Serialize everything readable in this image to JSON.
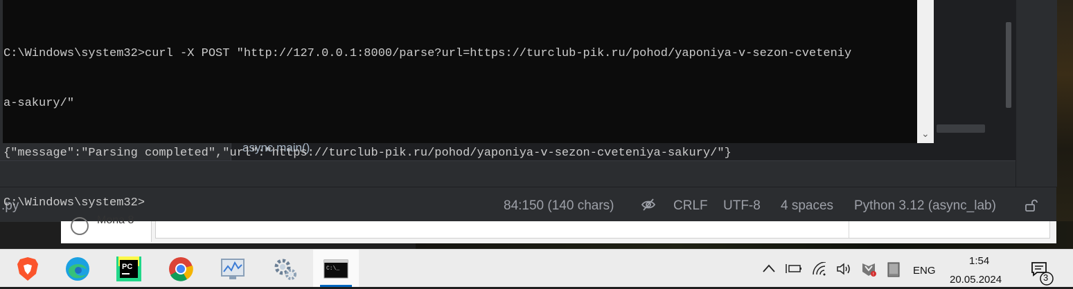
{
  "terminal": {
    "lines": [
      "C:\\Windows\\system32>curl -X POST \"http://127.0.0.1:8000/parse?url=https://turclub-pik.ru/pohod/yaponiya-v-sezon-cveteniy",
      "a-sakury/\"",
      "{\"message\":\"Parsing completed\",\"url\":\"https://turclub-pik.ru/pohod/yaponiya-v-sezon-cveteniya-sakury/\"}",
      "C:\\Windows\\system32>"
    ]
  },
  "ide": {
    "breadcrumb": "async main()",
    "status": {
      "file": ".py",
      "position": "84:150 (140 chars)",
      "line_ending": "CRLF",
      "encoding": "UTF-8",
      "indent": "4 spaces",
      "interpreter": "Python 3.12 (async_lab)"
    }
  },
  "lower_window": {
    "cut_text": "Mona 8"
  },
  "taskbar": {
    "apps": [
      {
        "name": "Brave",
        "icon": "brave-icon"
      },
      {
        "name": "Edge",
        "icon": "edge-icon"
      },
      {
        "name": "PyCharm",
        "icon": "pycharm-icon"
      },
      {
        "name": "Chrome",
        "icon": "chrome-icon"
      },
      {
        "name": "Resource Monitor",
        "icon": "monitor-icon"
      },
      {
        "name": "Settings",
        "icon": "gears-icon"
      },
      {
        "name": "Command Prompt",
        "icon": "cmd-icon",
        "active": true
      }
    ],
    "tray": {
      "language": "ENG",
      "time": "1:54",
      "date": "20.05.2024",
      "notifications": "3"
    }
  },
  "colors": {
    "terminal_bg": "#0c0c0c",
    "terminal_fg": "#cccccc",
    "ide_bg": "#2b2d30",
    "taskbar_bg": "#ececec",
    "accent": "#0067c0"
  }
}
